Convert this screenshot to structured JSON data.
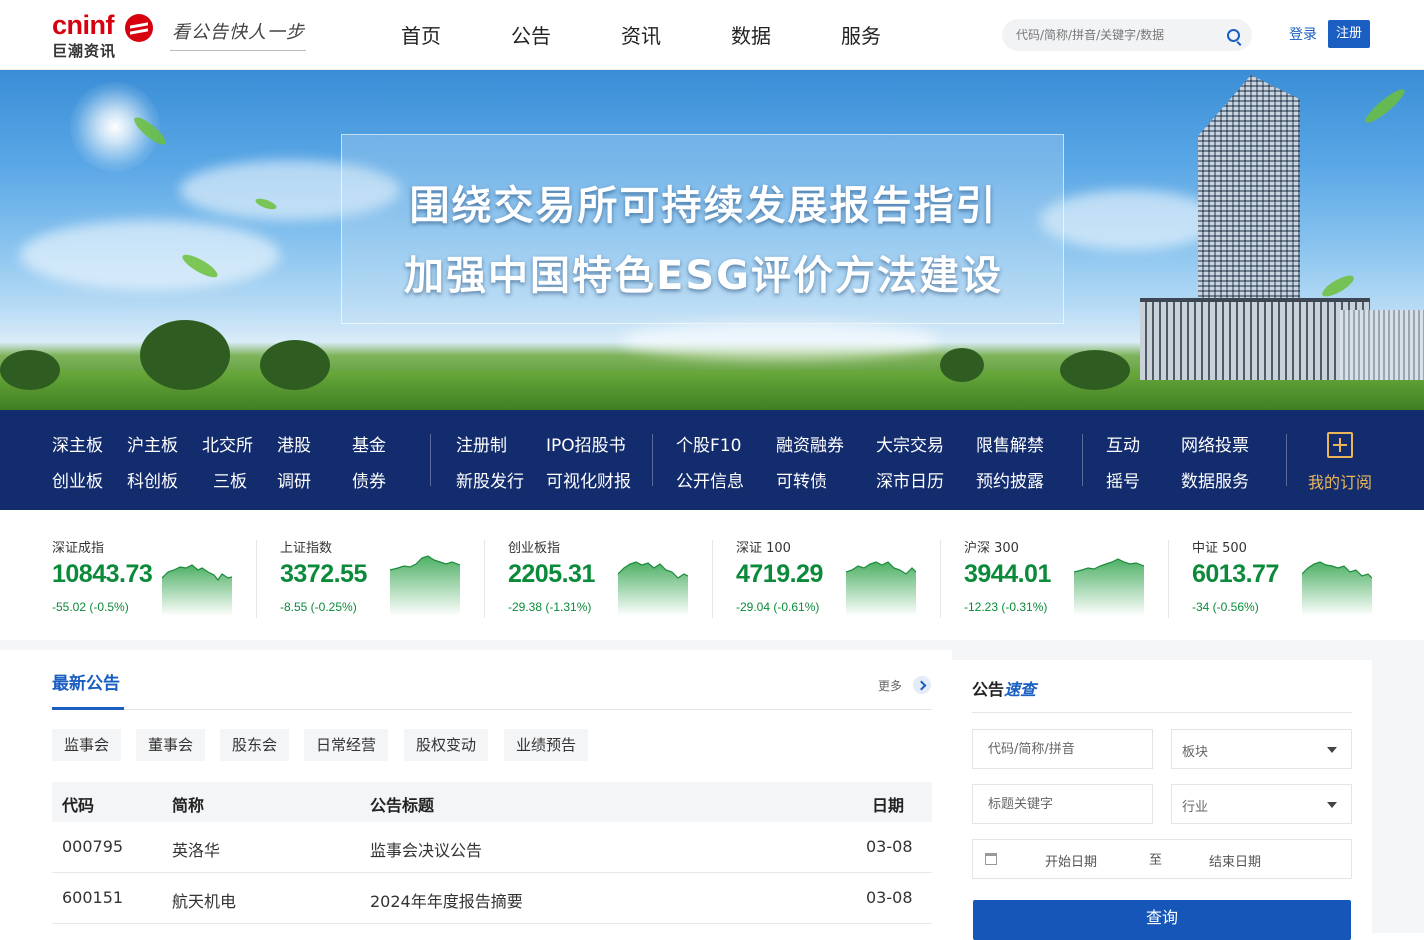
{
  "header": {
    "logo_en": "cninf",
    "logo_cn": "巨潮资讯",
    "slogan": "看公告快人一步",
    "nav": [
      "首页",
      "公告",
      "资讯",
      "数据",
      "服务"
    ],
    "search_placeholder": "代码/简称/拼音/关键字/数据",
    "login": "登录",
    "register": "注册"
  },
  "banner": {
    "line1": "围绕交易所可持续发展报告指引",
    "line2": "加强中国特色ESG评价方法建设"
  },
  "quick_nav": {
    "g1_row1": [
      "深主板",
      "沪主板",
      "北交所",
      "港股",
      "基金"
    ],
    "g1_row2": [
      "创业板",
      "科创板",
      "三板",
      "调研",
      "债券"
    ],
    "g2_row1": [
      "注册制",
      "IPO招股书"
    ],
    "g2_row2": [
      "新股发行",
      "可视化财报"
    ],
    "g3_row1": [
      "个股F10",
      "融资融券",
      "大宗交易",
      "限售解禁"
    ],
    "g3_row2": [
      "公开信息",
      "可转债",
      "深市日历",
      "预约披露"
    ],
    "g4_row1": [
      "互动",
      "网络投票"
    ],
    "g4_row2": [
      "摇号",
      "数据服务"
    ],
    "subscribe": "我的订阅"
  },
  "indices": [
    {
      "name": "深证成指",
      "value": "10843.73",
      "change": "-55.02 (-0.5%)"
    },
    {
      "name": "上证指数",
      "value": "3372.55",
      "change": "-8.55 (-0.25%)"
    },
    {
      "name": "创业板指",
      "value": "2205.31",
      "change": "-29.38 (-1.31%)"
    },
    {
      "name": "深证 100",
      "value": "4719.29",
      "change": "-29.04 (-0.61%)"
    },
    {
      "name": "沪深 300",
      "value": "3944.01",
      "change": "-12.23 (-0.31%)"
    },
    {
      "name": "中证 500",
      "value": "6013.77",
      "change": "-34 (-0.56%)"
    }
  ],
  "colors": {
    "up_down_green": "#0b8a3a",
    "brand_blue": "#1a5ec2",
    "nav_bar": "#132c6e",
    "gold": "#e9b65a"
  },
  "announcements": {
    "title": "最新公告",
    "more": "更多",
    "tags": [
      "监事会",
      "董事会",
      "股东会",
      "日常经营",
      "股权变动",
      "业绩预告"
    ],
    "columns": [
      "代码",
      "简称",
      "公告标题",
      "日期"
    ],
    "rows": [
      [
        "000795",
        "英洛华",
        "监事会决议公告",
        "03-08"
      ],
      [
        "600151",
        "航天机电",
        "2024年年度报告摘要",
        "03-08"
      ]
    ]
  },
  "quick_search": {
    "title_a": "公告",
    "title_b": "速查",
    "code_placeholder": "代码/简称/拼音",
    "board_label": "板块",
    "keyword_placeholder": "标题关键字",
    "industry_label": "行业",
    "start_date": "开始日期",
    "to": "至",
    "end_date": "结束日期",
    "query": "查询"
  }
}
